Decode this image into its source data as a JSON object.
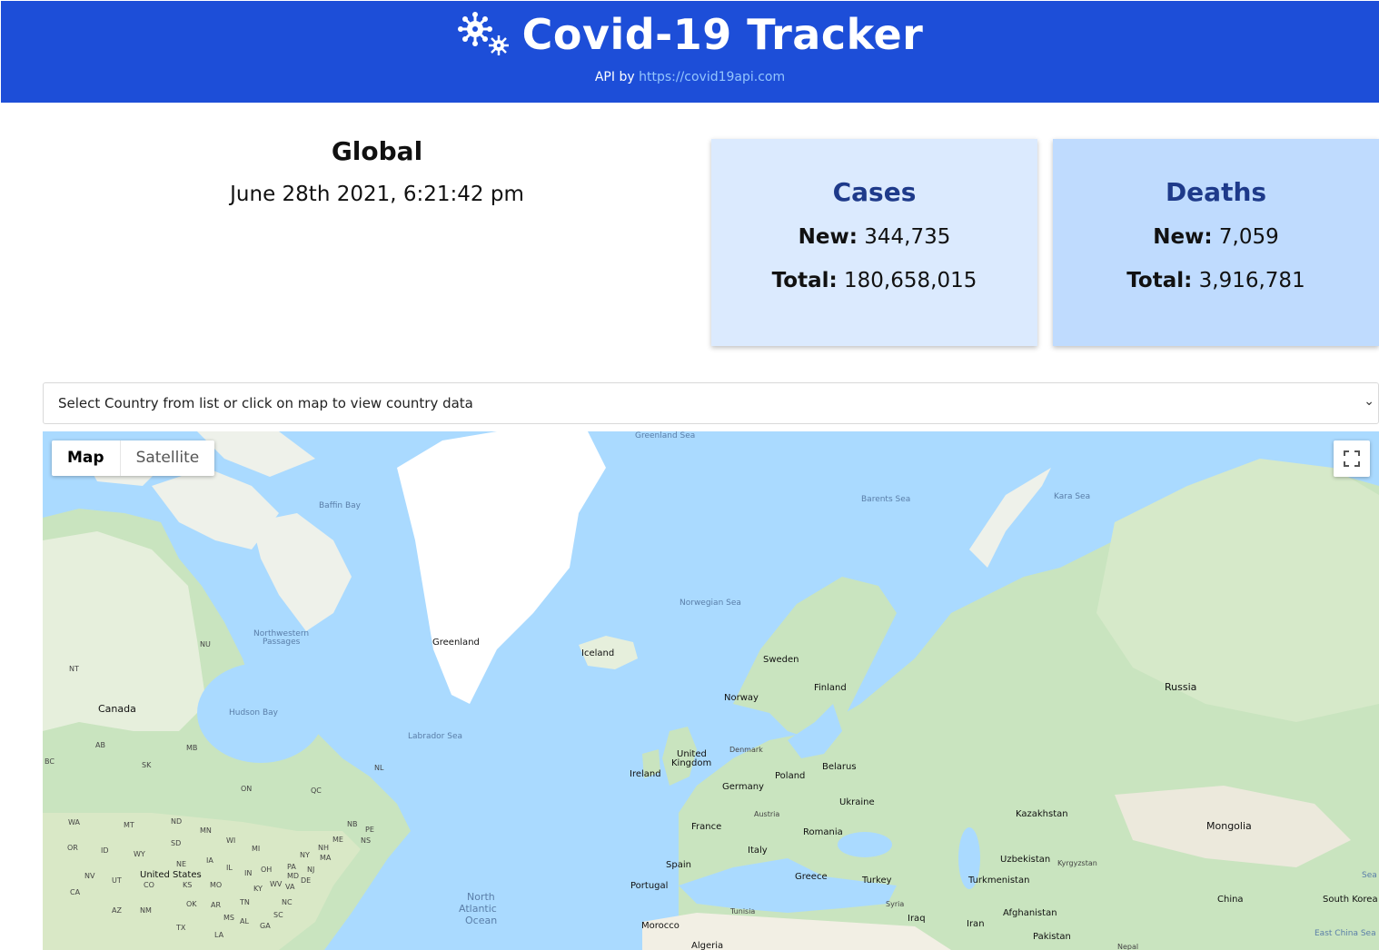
{
  "header": {
    "title": "Covid-19 Tracker",
    "api_prefix": "API by",
    "api_link": "https://covid19api.com",
    "logo_icon": "virus-icon",
    "background_color": "#1d4ed8"
  },
  "global": {
    "title": "Global",
    "date": "June 28th 2021, 6:21:42 pm"
  },
  "cards": {
    "cases": {
      "title": "Cases",
      "new_label": "New:",
      "new_value": "344,735",
      "total_label": "Total:",
      "total_value": "180,658,015",
      "background": "#dbeafe"
    },
    "deaths": {
      "title": "Deaths",
      "new_label": "New:",
      "new_value": "7,059",
      "total_label": "Total:",
      "total_value": "3,916,781",
      "background": "#bfdbfe"
    }
  },
  "country_select": {
    "placeholder": "Select Country from list or click on map to view country data",
    "icon": "chevron-down-icon"
  },
  "map": {
    "type_buttons": [
      "Map",
      "Satellite"
    ],
    "active_type": "Map",
    "fullscreen_icon": "fullscreen-icon",
    "water_color": "#aadaff",
    "labels": {
      "greenland_sea": "Greenland Sea",
      "baffin_bay": "Baffin Bay",
      "barents_sea": "Barents Sea",
      "kara_sea": "Kara Sea",
      "norwegian_sea": "Norwegian Sea",
      "northwestern": "Northwestern",
      "passages": "Passages",
      "nu": "NU",
      "nt": "NT",
      "greenland": "Greenland",
      "iceland": "Iceland",
      "sweden": "Sweden",
      "finland": "Finland",
      "norway": "Norway",
      "russia": "Russia",
      "canada": "Canada",
      "hudson_bay": "Hudson Bay",
      "labrador_sea": "Labrador Sea",
      "ab": "AB",
      "mb": "MB",
      "bc": "BC",
      "sk": "SK",
      "nl": "NL",
      "on": "ON",
      "qc": "QC",
      "united": "United",
      "kingdom": "Kingdom",
      "denmark": "Denmark",
      "ireland": "Ireland",
      "poland": "Poland",
      "belarus": "Belarus",
      "germany": "Germany",
      "ukraine": "Ukraine",
      "kazakhstan": "Kazakhstan",
      "austria": "Austria",
      "france": "France",
      "romania": "Romania",
      "mongolia": "Mongolia",
      "italy": "Italy",
      "spain": "Spain",
      "portugal": "Portugal",
      "greece": "Greece",
      "turkey": "Turkey",
      "uzbekistan": "Uzbekistan",
      "kyrgyzstan": "Kyrgyzstan",
      "turkmenistan": "Turkmenistan",
      "china": "China",
      "south_korea": "South Korea",
      "sea": "Sea",
      "syria": "Syria",
      "iraq": "Iraq",
      "iran": "Iran",
      "afghanistan": "Afghanistan",
      "tunisia": "Tunisia",
      "morocco": "Morocco",
      "algeria": "Algeria",
      "pakistan": "Pakistan",
      "nepal": "Nepal",
      "east_china_sea": "East China Sea",
      "north": "North",
      "atlantic": "Atlantic",
      "ocean": "Ocean",
      "united_states": "United States",
      "wa": "WA",
      "mt": "MT",
      "nd": "ND",
      "mn": "MN",
      "or": "OR",
      "id": "ID",
      "wy": "WY",
      "sd": "SD",
      "wi": "WI",
      "mi": "MI",
      "ny": "NY",
      "ne": "NE",
      "ia": "IA",
      "nv": "NV",
      "ut": "UT",
      "co": "CO",
      "ks": "KS",
      "mo": "MO",
      "il": "IL",
      "in": "IN",
      "oh": "OH",
      "pa": "PA",
      "ca": "CA",
      "az": "AZ",
      "nm": "NM",
      "ok": "OK",
      "ar": "AR",
      "tn": "TN",
      "ky": "KY",
      "wv": "WV",
      "va": "VA",
      "nc": "NC",
      "sc": "SC",
      "ms": "MS",
      "al": "AL",
      "ga": "GA",
      "tx": "TX",
      "la": "LA",
      "md": "MD",
      "de": "DE",
      "nj": "NJ",
      "ma": "MA",
      "nh": "NH",
      "me": "ME",
      "nb": "NB",
      "pe": "PE",
      "ns": "NS"
    }
  }
}
